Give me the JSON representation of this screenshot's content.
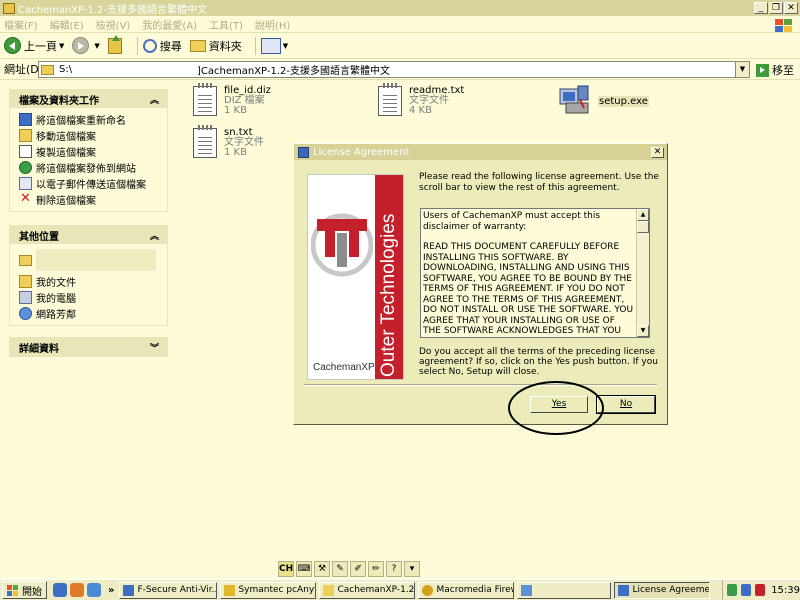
{
  "window": {
    "title": "CachemanXP-1.2-支援多國語言繁體中文"
  },
  "menu": [
    "檔案(F)",
    "編輯(E)",
    "檢視(V)",
    "我的最愛(A)",
    "工具(T)",
    "說明(H)"
  ],
  "toolbar": {
    "back": "上一頁",
    "search": "搜尋",
    "folders": "資料夾"
  },
  "address": {
    "label": "網址(D)",
    "path_prefix": "S:\\",
    "path_suffix": "]CachemanXP-1.2-支援多國語言繁體中文",
    "go": "移至"
  },
  "sidebar": {
    "tasks": {
      "title": "檔案及資料夾工作",
      "items": [
        "將這個檔案重新命名",
        "移動這個檔案",
        "複製這個檔案",
        "將這個檔案發佈到網站",
        "以電子郵件傳送這個檔案",
        "刪除這個檔案"
      ]
    },
    "places": {
      "title": "其他位置",
      "items": [
        "",
        "我的文件",
        "我的電腦",
        "網路芳鄰"
      ]
    },
    "details": {
      "title": "詳細資料"
    }
  },
  "files": [
    {
      "name": "file_id.diz",
      "type": "DIZ 檔案",
      "size": "1 KB"
    },
    {
      "name": "readme.txt",
      "type": "文字文件",
      "size": "4 KB"
    },
    {
      "name": "setup.exe",
      "type": "",
      "size": ""
    },
    {
      "name": "sn.txt",
      "type": "文字文件",
      "size": "1 KB"
    }
  ],
  "dialog": {
    "title": "License Agreement",
    "intro": "Please read the following license agreement.  Use the scroll bar to view the rest of this agreement.",
    "license_p1": "Users of CachemanXP must accept this disclaimer of warranty:",
    "license_p2": "READ THIS DOCUMENT CAREFULLY BEFORE INSTALLING THIS SOFTWARE. BY DOWNLOADING, INSTALLING AND USING THIS SOFTWARE, YOU AGREE TO BE BOUND BY THE TERMS OF THIS AGREEMENT. IF YOU DO NOT AGREE TO THE TERMS OF THIS AGREEMENT, DO NOT INSTALL OR USE THE SOFTWARE. YOU AGREE THAT YOUR INSTALLING OR USE OF THE SOFTWARE ACKNOWLEDGES THAT YOU HAVE READ THIS",
    "question": "Do you accept all the terms of the preceding license agreement? If so, click on the Yes push button. If you select No, Setup will close.",
    "yes": "Yes",
    "no": "No",
    "logo_vertical": "Outer Technologies",
    "logo_brand": "CachemanXP"
  },
  "langbar": {
    "lang": "CH"
  },
  "taskbar": {
    "start": "開始",
    "items": [
      "F-Secure Anti-Vir...",
      "Symantec pcAnyw...",
      "CachemanXP-1.2-...",
      "Macromedia Firew...",
      "",
      "License Agreement"
    ],
    "clock": "15:39"
  },
  "colors": {
    "accent_red": "#c4202b",
    "window_bg": "#fdfbd8",
    "titlebar": "#d8d59a"
  }
}
